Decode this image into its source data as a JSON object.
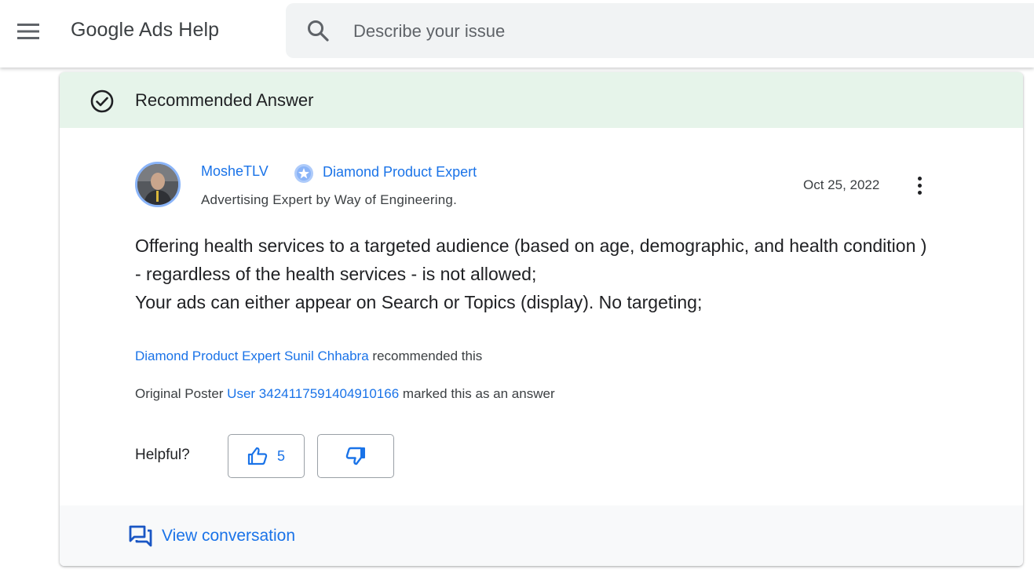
{
  "header": {
    "app_title": "Google Ads Help",
    "search_placeholder": "Describe your issue"
  },
  "recommended": {
    "title": "Recommended Answer"
  },
  "post": {
    "author_name": "MosheTLV",
    "badge_label": "Diamond Product Expert",
    "author_title": "Advertising Expert by Way of Engineering.",
    "date": "Oct 25, 2022",
    "body": [
      "Offering health services to a targeted audience (based on age, demographic, and health condition ) - regardless of the health services - is not allowed;",
      "Your ads can either appear on Search or Topics (display). No targeting;"
    ]
  },
  "recommendation": {
    "recommender_badge": "Diamond Product Expert",
    "recommender_name": "Sunil Chhabra",
    "suffix": "recommended this"
  },
  "original_poster": {
    "prefix": "Original Poster",
    "user": "User 3424117591404910166",
    "suffix": "marked this as an answer"
  },
  "helpful": {
    "label": "Helpful?",
    "upvote_count": "5"
  },
  "footer": {
    "view_conversation_label": "View conversation"
  },
  "colors": {
    "accent": "#1a73e8",
    "banner_bg": "#e6f4ea",
    "footer_bg": "#f8f9fa"
  },
  "icons": {
    "menu": "hamburger-menu-icon",
    "search": "search-icon",
    "recommended": "check-circle-icon",
    "badge": "diamond-badge-icon",
    "more": "more-vert-icon",
    "thumbs_up": "thumb-up-icon",
    "thumbs_down": "thumb-down-icon",
    "conversation": "forum-icon"
  }
}
